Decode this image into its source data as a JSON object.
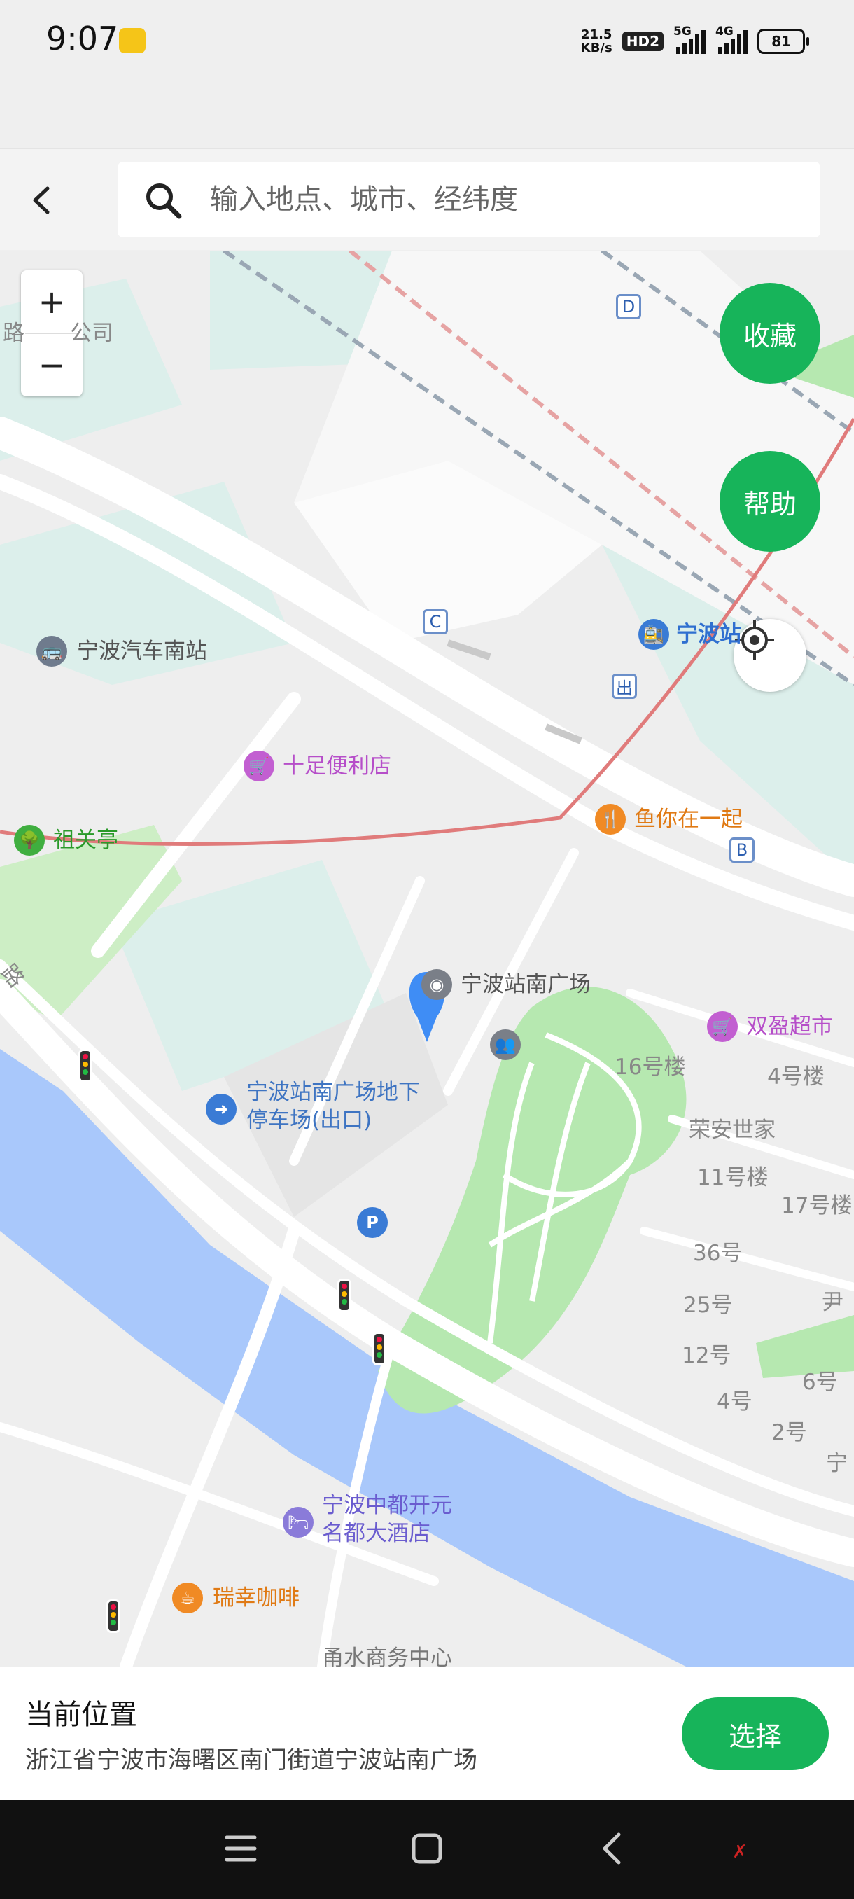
{
  "status_bar": {
    "time": "9:07",
    "net_speed_value": "21.5",
    "net_speed_unit": "KB/s",
    "hd_badge": "HD2",
    "signal_5g": "5G",
    "signal_4g": "4G",
    "battery": "81"
  },
  "header": {
    "search_placeholder": "输入地点、城市、经纬度"
  },
  "map": {
    "zoom_in": "+",
    "zoom_out": "−",
    "favorite_button": "收藏",
    "help_button": "帮助",
    "road_labels": {
      "top_left": "路",
      "top_left_company": "公司",
      "left_road": "路"
    },
    "gates": {
      "d": "D",
      "c": "C",
      "exit": "出",
      "b": "B"
    },
    "pois": {
      "bus_station": "宁波汽车南站",
      "railway_station": "宁波站",
      "convenience_store": "十足便利店",
      "zuguan_pavilion": "祖关亭",
      "restaurant": "鱼你在一起",
      "south_square": "宁波站南广场",
      "supermarket": "双盈超市",
      "parking_exit_line1": "宁波站南广场地下",
      "parking_exit_line2": "停车场(出口)",
      "hotel_line1": "宁波中都开元",
      "hotel_line2": "名都大酒店",
      "coffee": "瑞幸咖啡",
      "business_center": "甬水商务中心"
    },
    "buildings": {
      "b16": "16号楼",
      "b4": "4号楼",
      "rongan": "荣安世家",
      "b11": "11号楼",
      "b17": "17号楼",
      "n36": "36号",
      "n25": "25号",
      "yin": "尹",
      "n12": "12号",
      "n6": "6号",
      "n4": "4号",
      "n2": "2号",
      "ning": "宁"
    }
  },
  "bottom_panel": {
    "title": "当前位置",
    "address": "浙江省宁波市海曙区南门街道宁波站南广场",
    "select_button": "选择"
  },
  "colors": {
    "accent": "#17b45a",
    "water": "#a9c8fb",
    "park": "#b6e8b0",
    "rail_line": "#e07b7b"
  }
}
